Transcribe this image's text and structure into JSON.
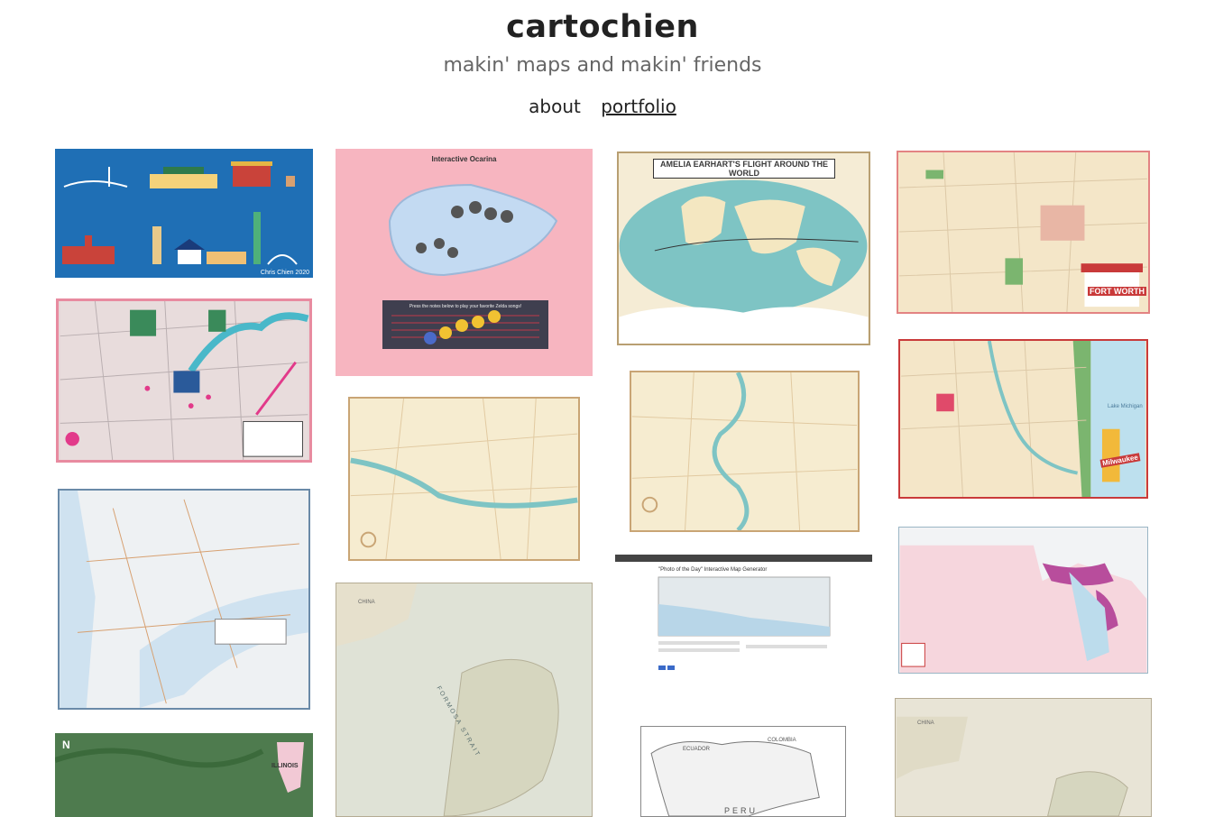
{
  "site": {
    "title": "cartochien",
    "tagline": "makin' maps and makin' friends"
  },
  "nav": {
    "items": [
      {
        "label": "about",
        "active": false
      },
      {
        "label": "portfolio",
        "active": true
      }
    ]
  },
  "portfolio": {
    "taipei_credit": "Chris Chien 2020",
    "ocarina_title": "Interactive Ocarina",
    "ocarina_instruction": "Press the notes below to play your favorite Zelda songs!",
    "ocarina_notes": [
      "A",
      "▼",
      "▶",
      "◀",
      "▲"
    ],
    "earhart_title": "AMELIA EARHART'S FLIGHT AROUND THE WORLD",
    "fortworth_title": "FORT WORTH",
    "milwaukee_label": "Milwaukee",
    "lake_label": "Lake Michigan",
    "generator_title": "\"Photo of the Day\" Interactive Map Generator",
    "illinois_label": "ILLINOIS",
    "north_label": "N",
    "china_label": "CHINA",
    "formosa_label": "FORMOSA STRAIT",
    "ecuador_label": "ECUADOR",
    "colombia_label": "COLOMBIA",
    "peru_label": "PERU"
  },
  "colors": {
    "accent_blue": "#1f6fb5",
    "ocarina_pink": "#f7b5c0",
    "map_cream": "#f6ecd0",
    "river_teal": "#7ec4c4"
  }
}
